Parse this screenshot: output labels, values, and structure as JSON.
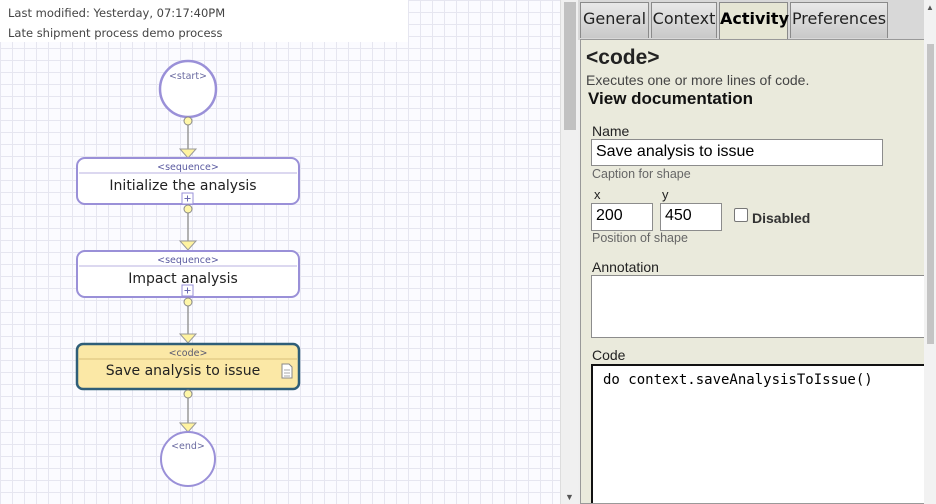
{
  "header": {
    "last_modified": "Last modified: Yesterday, 07:17:40PM",
    "description": "Late shipment process demo process"
  },
  "flow": {
    "start_label": "<start>",
    "end_label": "<end>",
    "nodes": [
      {
        "type": "<sequence>",
        "name": "Initialize the analysis"
      },
      {
        "type": "<sequence>",
        "name": "Impact analysis"
      },
      {
        "type": "<code>",
        "name": "Save analysis to issue"
      }
    ]
  },
  "tabs": [
    "General",
    "Context",
    "Activity",
    "Preferences"
  ],
  "active_tab": "Activity",
  "activity": {
    "title": "<code>",
    "description": "Executes one or more lines of code.",
    "doc_link": "View documentation",
    "name_label": "Name",
    "name_value": "Save analysis to issue",
    "name_hint": "Caption for shape",
    "x_label": "x",
    "y_label": "y",
    "x_value": "200",
    "y_value": "450",
    "disabled_label": "Disabled",
    "position_hint": "Position of shape",
    "annotation_label": "Annotation",
    "annotation_value": "",
    "code_label": "Code",
    "code_value": "do context.saveAnalysisToIssue()"
  },
  "colors": {
    "node_border": "#9a90d8",
    "selected_fill": "#fbe8a6",
    "selected_border": "#2f5e78",
    "connector": "#999999",
    "active_tab_bg": "#e6e6d4",
    "panel_bg": "#eaeadc"
  }
}
